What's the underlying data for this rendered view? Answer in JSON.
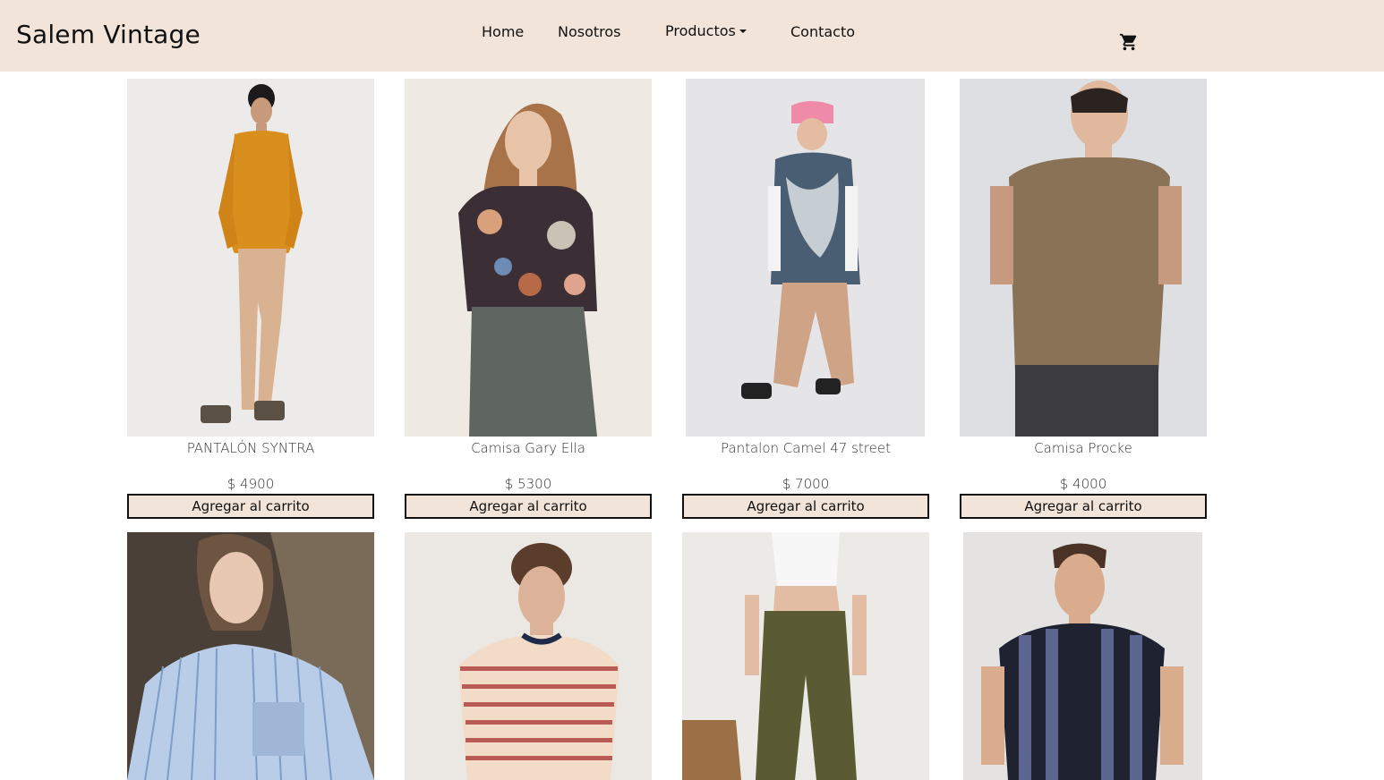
{
  "brand": "Salem Vintage",
  "nav": {
    "home": "Home",
    "about": "Nosotros",
    "products": "Productos",
    "contact": "Contacto"
  },
  "cart_icon": "shopping-cart-icon",
  "colors": {
    "navbar_bg": "#f2e4d9",
    "button_bg": "#f2e4d9",
    "button_border": "#111111"
  },
  "products": [
    {
      "name": "PANTALÓN SYNTRA",
      "price": "$ 4900",
      "button": "Agregar al carrito"
    },
    {
      "name": "Camisa Gary Ella",
      "price": "$ 5300",
      "button": "Agregar al carrito"
    },
    {
      "name": "Pantalon Camel 47 street",
      "price": "$ 7000",
      "button": "Agregar al carrito"
    },
    {
      "name": "Camisa Procke",
      "price": "$ 4000",
      "button": "Agregar al carrito"
    }
  ]
}
